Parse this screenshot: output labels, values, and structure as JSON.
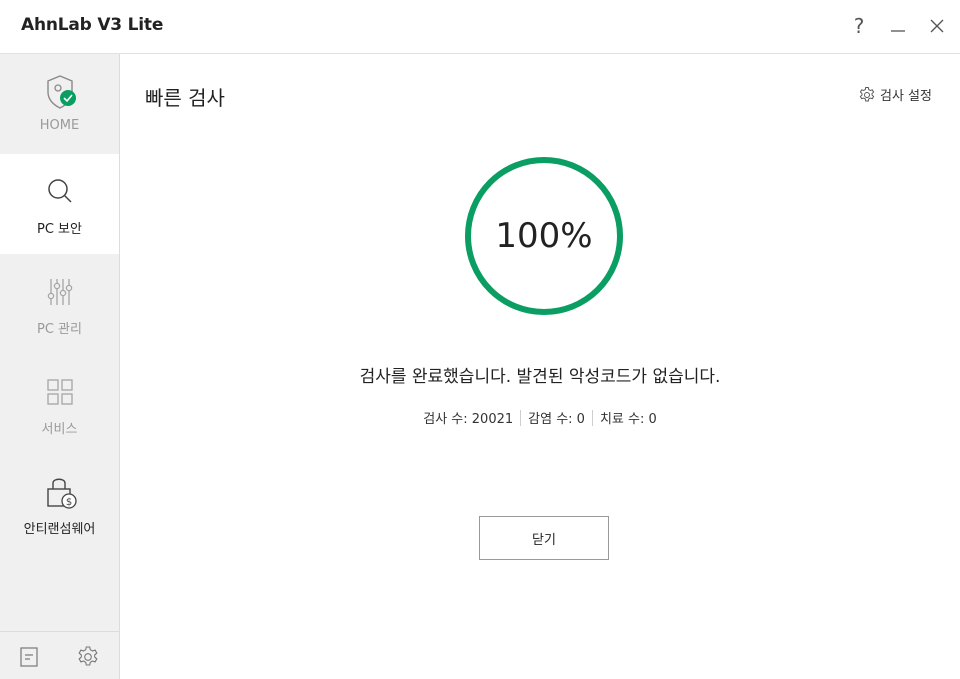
{
  "window": {
    "title": "AhnLab V3 Lite",
    "help_label": "?"
  },
  "sidebar": {
    "items": [
      {
        "label": "HOME",
        "icon": "shield-check-icon"
      },
      {
        "label": "PC 보안",
        "icon": "search-icon"
      },
      {
        "label": "PC 관리",
        "icon": "sliders-icon"
      },
      {
        "label": "서비스",
        "icon": "grid-icon"
      },
      {
        "label": "안티랜섬웨어",
        "icon": "lock-dollar-icon"
      }
    ],
    "bottom": [
      {
        "icon": "document-icon"
      },
      {
        "icon": "gear-icon"
      }
    ]
  },
  "main": {
    "title": "빠른 검사",
    "settings_label": "검사 설정",
    "progress_text": "100%",
    "progress_value": 100,
    "result_message": "검사를 완료했습니다. 발견된 악성코드가 없습니다.",
    "stats": {
      "scanned": "검사 수: 20021",
      "infected": "감염 수: 0",
      "cured": "치료 수: 0"
    },
    "close_button": "닫기"
  },
  "colors": {
    "accent_green": "#0a9e63",
    "sidebar_bg": "#f0f0f0"
  }
}
